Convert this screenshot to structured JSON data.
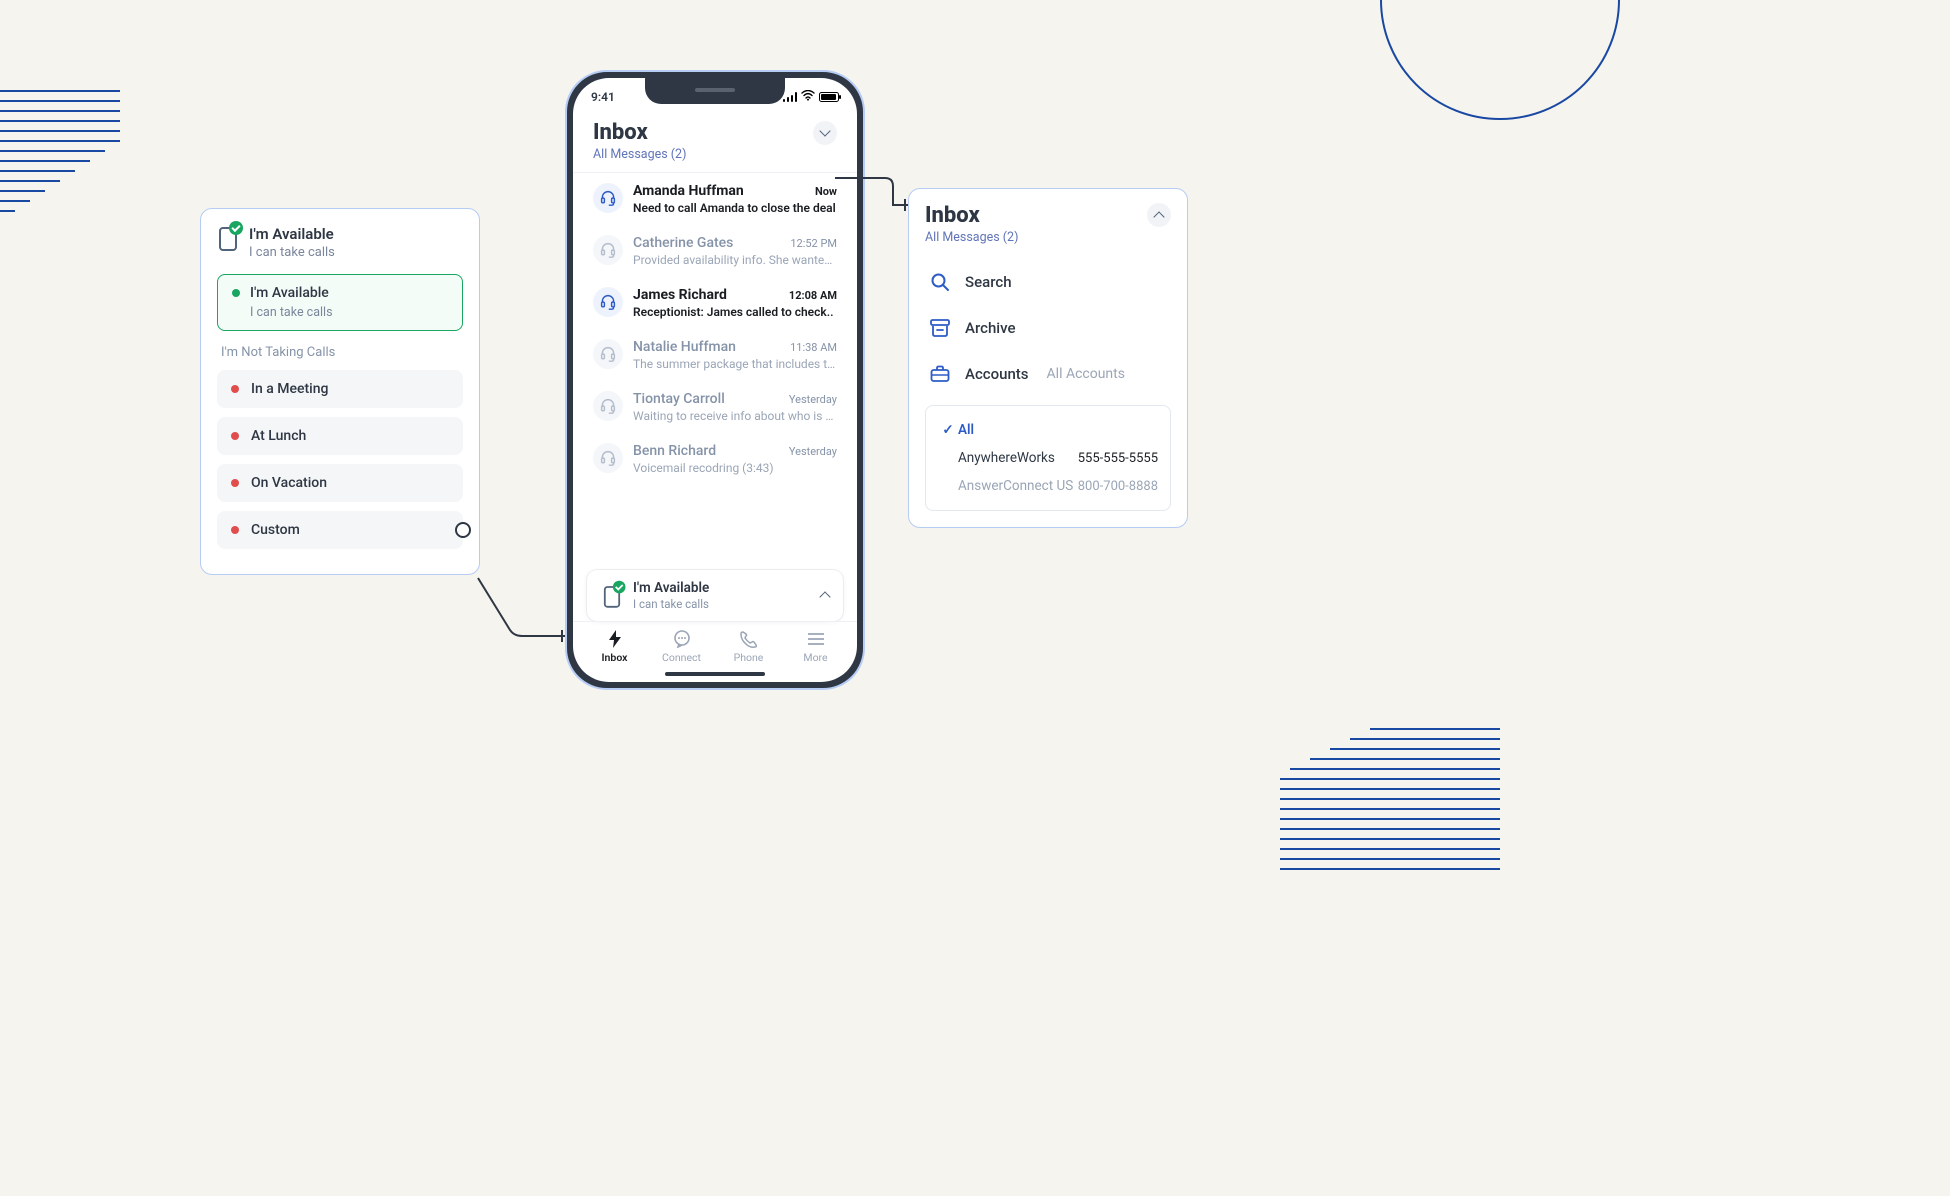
{
  "status_bar": {
    "time": "9:41"
  },
  "inbox": {
    "title": "Inbox",
    "subtitle": "All Messages (2)",
    "messages": [
      {
        "name": "Amanda Huffman",
        "preview": "Need to call Amanda to close the deal",
        "time": "Now",
        "unread": true
      },
      {
        "name": "Catherine Gates",
        "preview": "Provided availability info. She wanted to..",
        "time": "12:52 PM",
        "unread": false
      },
      {
        "name": "James Richard",
        "preview": "Receptionist: James called to check..",
        "time": "12:08 AM",
        "unread": true
      },
      {
        "name": "Natalie Huffman",
        "preview": "The summer package that includes the..",
        "time": "11:38 AM",
        "unread": false
      },
      {
        "name": "Tiontay Carroll",
        "preview": "Waiting to receive info about who is fre..",
        "time": "Yesterday",
        "unread": false
      },
      {
        "name": "Benn Richard",
        "preview": "Voicemail recodring (3:43)",
        "time": "Yesterday",
        "unread": false
      }
    ],
    "availability": {
      "title": "I'm Available",
      "sub": "I can take calls"
    },
    "tabs": [
      {
        "label": "Inbox"
      },
      {
        "label": "Connect"
      },
      {
        "label": "Phone"
      },
      {
        "label": "More"
      }
    ]
  },
  "status_card": {
    "header_title": "I'm Available",
    "header_sub": "I can take calls",
    "active_title": "I'm Available",
    "active_sub": "I can take calls",
    "section_label": "I'm Not Taking Calls",
    "options": [
      {
        "label": "In a Meeting"
      },
      {
        "label": "At Lunch"
      },
      {
        "label": "On Vacation"
      },
      {
        "label": "Custom"
      }
    ]
  },
  "inbox_panel": {
    "title": "Inbox",
    "subtitle": "All Messages (2)",
    "rows": {
      "search": "Search",
      "archive": "Archive",
      "accounts": "Accounts",
      "accounts_hint": "All Accounts"
    },
    "accounts": {
      "all_label": "All",
      "items": [
        {
          "name": "AnywhereWorks",
          "number": "555-555-5555",
          "muted": false
        },
        {
          "name": "AnswerConnect US",
          "number": "800-700-8888",
          "muted": true
        }
      ]
    }
  }
}
